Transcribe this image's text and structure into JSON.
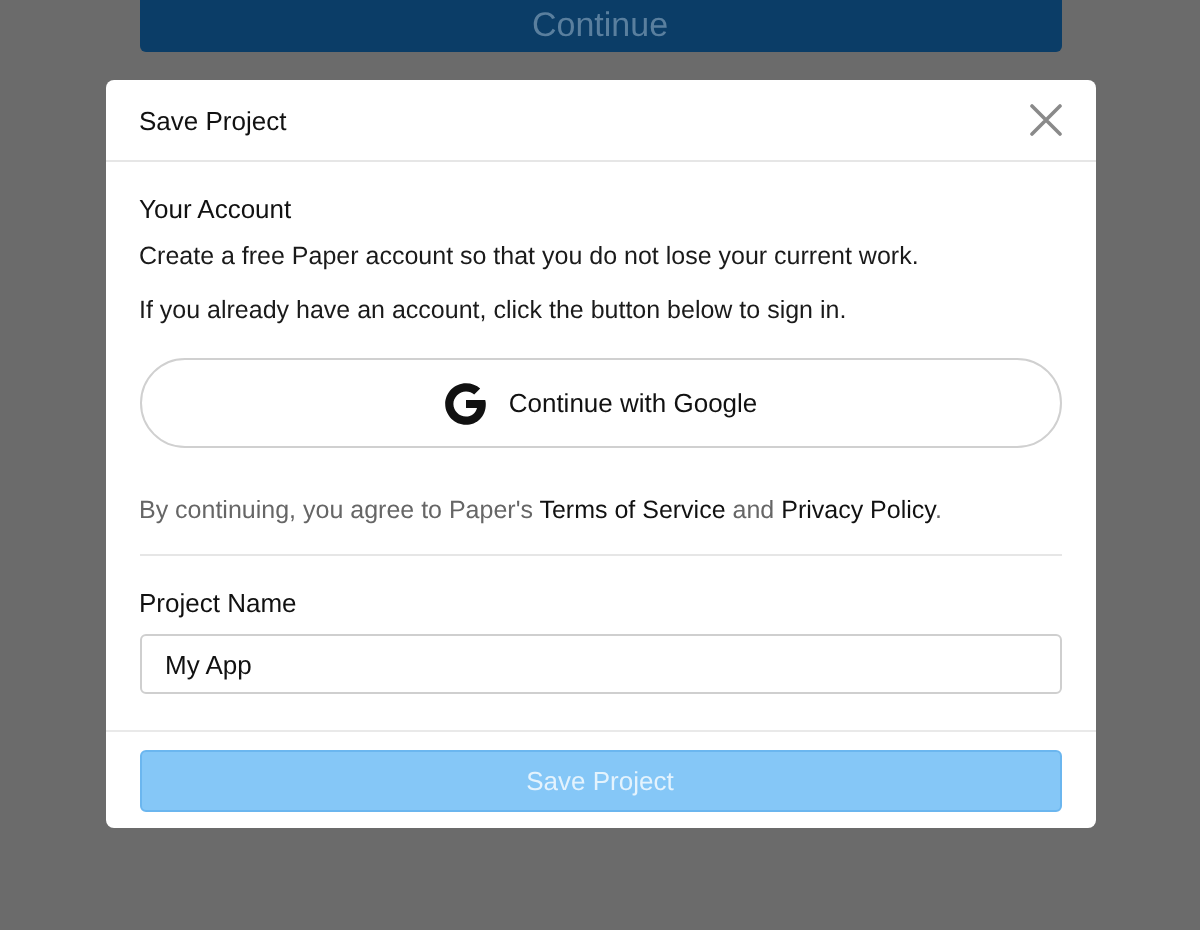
{
  "background_button": {
    "label": "Continue"
  },
  "dialog": {
    "title": "Save Project",
    "account": {
      "heading": "Your Account",
      "lines": [
        "Create a free Paper account so that you do not lose your current work.",
        "If you already have an account, click the button below to sign in."
      ]
    },
    "google_button": {
      "label": "Continue with Google"
    },
    "legal": [
      {
        "kind": "text",
        "text": "By continuing, you agree to Paper's "
      },
      {
        "kind": "link",
        "text": "Terms of Service"
      },
      {
        "kind": "text",
        "text": " and "
      },
      {
        "kind": "link",
        "text": "Privacy Policy"
      },
      {
        "kind": "text",
        "text": "."
      }
    ],
    "project_name": {
      "label": "Project Name",
      "value": "My App"
    },
    "save_button": {
      "label": "Save Project",
      "disabled": true
    }
  }
}
